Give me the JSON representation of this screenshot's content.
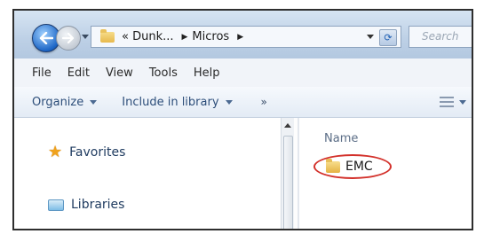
{
  "address_bar": {
    "parts": [
      "« Dunk...",
      "Micros"
    ],
    "separator_glyph": "▶",
    "refresh_glyph": "⟳"
  },
  "search": {
    "placeholder": "Search"
  },
  "menu": [
    "File",
    "Edit",
    "View",
    "Tools",
    "Help"
  ],
  "command_bar": {
    "organize": "Organize",
    "include": "Include in library",
    "more": "»"
  },
  "nav_pane": {
    "favorites": "Favorites",
    "libraries": "Libraries"
  },
  "content": {
    "column_name": "Name",
    "items": [
      "EMC"
    ]
  },
  "annotation": {
    "highlight_color": "#d3312b"
  },
  "icons": {
    "back": "back-arrow-icon",
    "forward": "forward-arrow-icon",
    "folder": "folder-icon",
    "favorites": "star-icon",
    "libraries": "library-icon",
    "views": "views-icon"
  }
}
